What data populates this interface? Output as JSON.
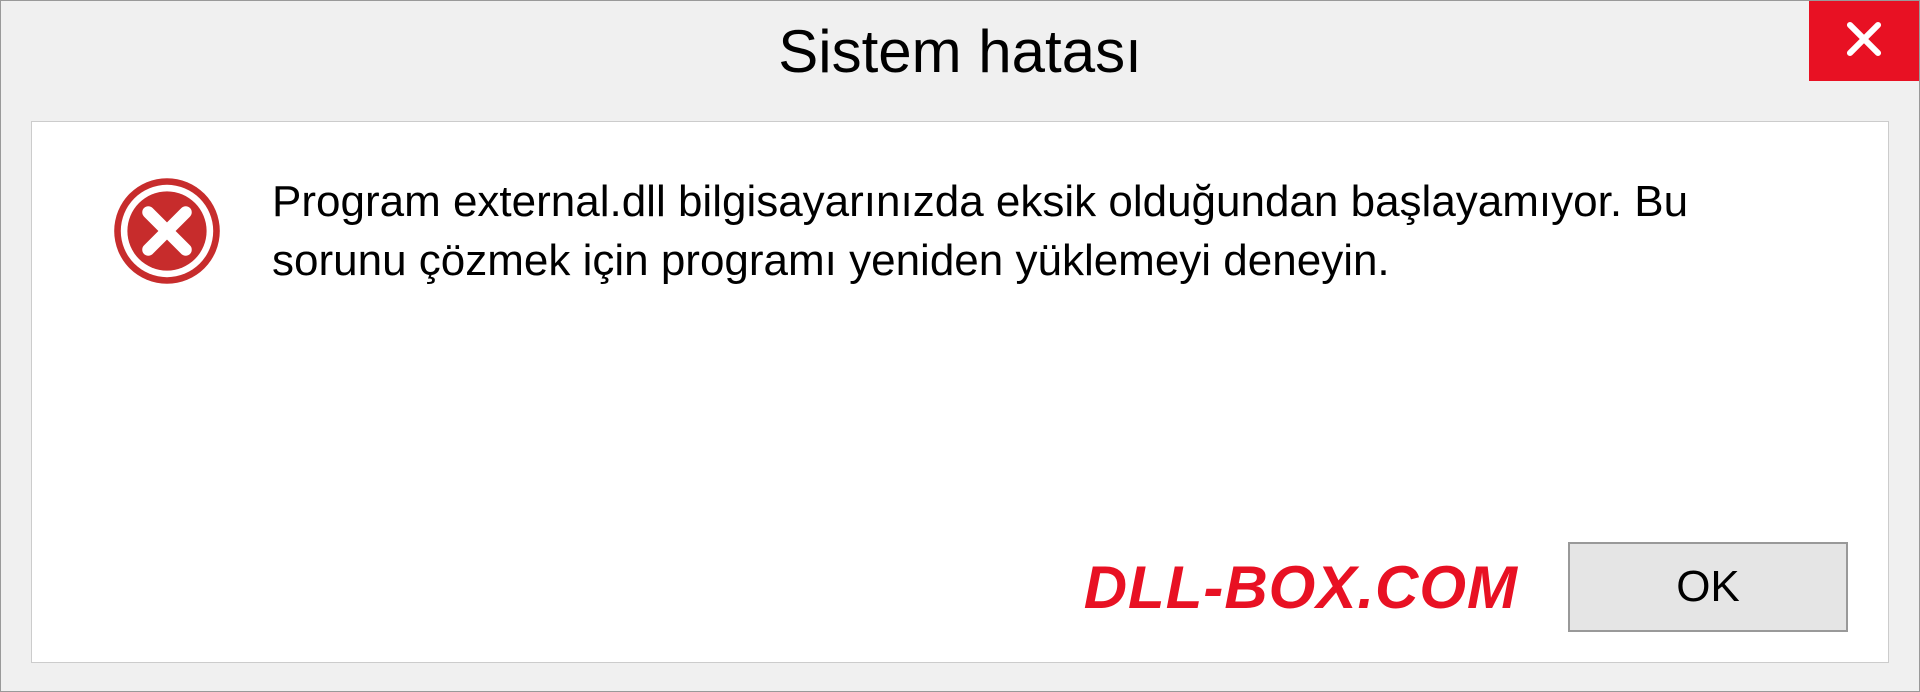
{
  "dialog": {
    "title": "Sistem hatası",
    "message": "Program external.dll bilgisayarınızda eksik olduğundan başlayamıyor. Bu sorunu çözmek için programı yeniden yüklemeyi deneyin.",
    "ok_label": "OK",
    "watermark": "DLL-BOX.COM"
  },
  "colors": {
    "close_red": "#e81123",
    "icon_red": "#c72c2c"
  }
}
